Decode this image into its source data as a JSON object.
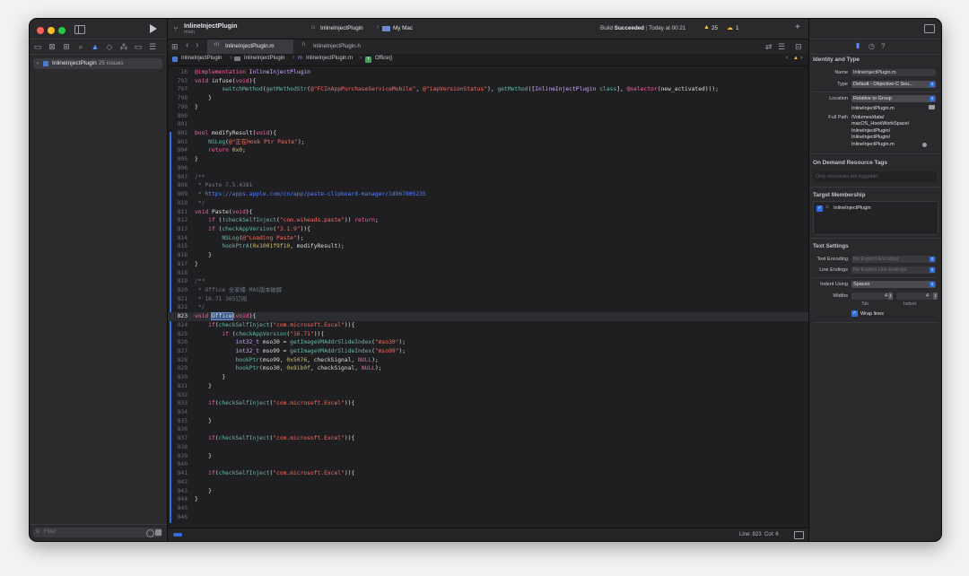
{
  "toolbar": {
    "project_name": "InlineInjectPlugin",
    "branch": "main",
    "scheme": "InlineInjectPlugin",
    "destination": "My Mac",
    "build_status_prefix": "Build",
    "build_status_word": "Succeeded",
    "build_time": "Today at 00:21",
    "warnings_count": "25",
    "errors_count": "1"
  },
  "navigator": {
    "root_item": "InlineInjectPlugin",
    "issues_label": "25 issues",
    "filter_placeholder": "Filter"
  },
  "tabs": [
    {
      "label": "InlineInjectPlugin.m",
      "icon": "m",
      "active": true
    },
    {
      "label": "InlineInjectPlugin.h",
      "icon": "h",
      "active": false
    }
  ],
  "jumpbar": {
    "project": "InlineInjectPlugin",
    "folder": "InlineInjectPlugin",
    "file": "InlineInjectPlugin.m",
    "symbol": "Office()"
  },
  "code_lines": [
    {
      "n": "16",
      "s": [
        [
          "kw",
          "@implementation"
        ],
        [
          "pl",
          " "
        ],
        [
          "ty",
          "InlineInjectPlugin"
        ]
      ]
    },
    {
      "n": "793",
      "s": [
        [
          "kw",
          "void"
        ],
        [
          "pl",
          " "
        ],
        [
          "pl",
          "infuse"
        ],
        [
          "pl",
          "("
        ],
        [
          "kw",
          "void"
        ],
        [
          "pl",
          "){"
        ]
      ]
    },
    {
      "n": "797",
      "s": [
        [
          "pl",
          "        "
        ],
        [
          "fn",
          "switchMethod"
        ],
        [
          "pl",
          "("
        ],
        [
          "fn",
          "getMethodStr"
        ],
        [
          "pl",
          "("
        ],
        [
          "str",
          "@\"FCInAppPurchaseServiceMobile\""
        ],
        [
          "pl",
          ", "
        ],
        [
          "str",
          "@\"iapVersionStatus\""
        ],
        [
          "pl",
          "), "
        ],
        [
          "fn",
          "getMethod"
        ],
        [
          "pl",
          "(["
        ],
        [
          "ty",
          "InlineInjectPlugin"
        ],
        [
          "pl",
          " "
        ],
        [
          "fn",
          "class"
        ],
        [
          "pl",
          "], "
        ],
        [
          "kw",
          "@selector"
        ],
        [
          "pl",
          "(new_activated)));"
        ]
      ]
    },
    {
      "n": "798",
      "s": [
        [
          "pl",
          "    }"
        ]
      ]
    },
    {
      "n": "799",
      "s": [
        [
          "pl",
          "}"
        ]
      ]
    },
    {
      "n": "800",
      "s": []
    },
    {
      "n": "801",
      "s": []
    },
    {
      "n": "802",
      "s": [
        [
          "kw",
          "bool"
        ],
        [
          "pl",
          " modifyResult("
        ],
        [
          "kw",
          "void"
        ],
        [
          "pl",
          "){"
        ]
      ]
    },
    {
      "n": "803",
      "s": [
        [
          "pl",
          "    "
        ],
        [
          "fn",
          "NSLog"
        ],
        [
          "pl",
          "("
        ],
        [
          "str",
          "@\"正在Hook Ptr Paste\""
        ],
        [
          "pl",
          ");"
        ]
      ]
    },
    {
      "n": "804",
      "s": [
        [
          "pl",
          "    "
        ],
        [
          "kw",
          "return"
        ],
        [
          "pl",
          " "
        ],
        [
          "num",
          "0x0"
        ],
        [
          "pl",
          ";"
        ]
      ]
    },
    {
      "n": "805",
      "s": [
        [
          "pl",
          "}"
        ]
      ]
    },
    {
      "n": "806",
      "s": []
    },
    {
      "n": "807",
      "s": [
        [
          "cmt",
          "/**"
        ]
      ]
    },
    {
      "n": "808",
      "s": [
        [
          "cmt",
          " * Paste 7.5.4381"
        ]
      ]
    },
    {
      "n": "809",
      "s": [
        [
          "cmt",
          " * "
        ],
        [
          "link",
          "https://apps.apple.com/cn/app/paste-clipboard-manager/id967805235"
        ]
      ]
    },
    {
      "n": "810",
      "s": [
        [
          "cmt",
          " */"
        ]
      ]
    },
    {
      "n": "811",
      "s": [
        [
          "kw",
          "void"
        ],
        [
          "pl",
          " Paste("
        ],
        [
          "kw",
          "void"
        ],
        [
          "pl",
          "){"
        ]
      ]
    },
    {
      "n": "812",
      "s": [
        [
          "pl",
          "    "
        ],
        [
          "kw",
          "if"
        ],
        [
          "pl",
          " (!"
        ],
        [
          "fn",
          "checkSelfInject"
        ],
        [
          "pl",
          "("
        ],
        [
          "str",
          "\"com.wiheads.paste\""
        ],
        [
          "pl",
          ")) "
        ],
        [
          "kw",
          "return"
        ],
        [
          "pl",
          ";"
        ]
      ]
    },
    {
      "n": "813",
      "s": [
        [
          "pl",
          "    "
        ],
        [
          "kw",
          "if"
        ],
        [
          "pl",
          " ("
        ],
        [
          "fn",
          "checkAppVersion"
        ],
        [
          "pl",
          "("
        ],
        [
          "str",
          "\"3.1.9\""
        ],
        [
          "pl",
          ")){"
        ]
      ]
    },
    {
      "n": "814",
      "s": [
        [
          "pl",
          "        "
        ],
        [
          "fn",
          "NSLog"
        ],
        [
          "pl",
          "("
        ],
        [
          "str",
          "@\"Loading Paste\""
        ],
        [
          "pl",
          ");"
        ]
      ]
    },
    {
      "n": "815",
      "s": [
        [
          "pl",
          "        "
        ],
        [
          "fn",
          "hookPtrA"
        ],
        [
          "pl",
          "("
        ],
        [
          "num",
          "0x1001f9f10"
        ],
        [
          "pl",
          ", modifyResult);"
        ]
      ]
    },
    {
      "n": "816",
      "s": [
        [
          "pl",
          "    }"
        ]
      ]
    },
    {
      "n": "817",
      "s": [
        [
          "pl",
          "}"
        ]
      ]
    },
    {
      "n": "818",
      "s": []
    },
    {
      "n": "819",
      "s": [
        [
          "cmt",
          "/**"
        ]
      ]
    },
    {
      "n": "820",
      "s": [
        [
          "cmt",
          " * Office 全家桶 MAS版本破解"
        ]
      ]
    },
    {
      "n": "821",
      "s": [
        [
          "cmt",
          " * 16.71 365订阅"
        ]
      ]
    },
    {
      "n": "822",
      "s": [
        [
          "cmt",
          " */"
        ]
      ]
    },
    {
      "n": "823",
      "s": [
        [
          "kw",
          "void"
        ],
        [
          "pl",
          " "
        ],
        [
          "sel",
          "Office"
        ],
        [
          "pl",
          "("
        ],
        [
          "kw",
          "void"
        ],
        [
          "pl",
          "){"
        ]
      ]
    },
    {
      "n": "824",
      "s": [
        [
          "pl",
          "    "
        ],
        [
          "kw",
          "if"
        ],
        [
          "pl",
          "("
        ],
        [
          "fn",
          "checkSelfInject"
        ],
        [
          "pl",
          "("
        ],
        [
          "str",
          "\"com.microsoft.Excel\""
        ],
        [
          "pl",
          ")){"
        ]
      ]
    },
    {
      "n": "825",
      "s": [
        [
          "pl",
          "        "
        ],
        [
          "kw",
          "if"
        ],
        [
          "pl",
          " ("
        ],
        [
          "fn",
          "checkAppVersion"
        ],
        [
          "pl",
          "("
        ],
        [
          "str",
          "\"16.71\""
        ],
        [
          "pl",
          ")){"
        ]
      ]
    },
    {
      "n": "826",
      "s": [
        [
          "pl",
          "            "
        ],
        [
          "ty",
          "int32_t"
        ],
        [
          "pl",
          " mso30 = "
        ],
        [
          "fn",
          "getImageVMAddrSlideIndex"
        ],
        [
          "pl",
          "("
        ],
        [
          "str",
          "\"mso30\""
        ],
        [
          "pl",
          ");"
        ]
      ]
    },
    {
      "n": "827",
      "s": [
        [
          "pl",
          "            "
        ],
        [
          "ty",
          "int32_t"
        ],
        [
          "pl",
          " mso99 = "
        ],
        [
          "fn",
          "getImageVMAddrSlideIndex"
        ],
        [
          "pl",
          "("
        ],
        [
          "str",
          "\"mso99\""
        ],
        [
          "pl",
          ");"
        ]
      ]
    },
    {
      "n": "828",
      "s": [
        [
          "pl",
          "            "
        ],
        [
          "fn",
          "hookPtr"
        ],
        [
          "pl",
          "(mso99, "
        ],
        [
          "num",
          "0x5076"
        ],
        [
          "pl",
          ", checkSignal, "
        ],
        [
          "kw",
          "NULL"
        ],
        [
          "pl",
          ");"
        ]
      ]
    },
    {
      "n": "829",
      "s": [
        [
          "pl",
          "            "
        ],
        [
          "fn",
          "hookPtr"
        ],
        [
          "pl",
          "(mso30, "
        ],
        [
          "num",
          "0x8ib0f"
        ],
        [
          "pl",
          ", checkSignal, "
        ],
        [
          "kw",
          "NULL"
        ],
        [
          "pl",
          ");"
        ]
      ]
    },
    {
      "n": "830",
      "s": [
        [
          "pl",
          "        }"
        ]
      ]
    },
    {
      "n": "831",
      "s": [
        [
          "pl",
          "    }"
        ]
      ]
    },
    {
      "n": "832",
      "s": []
    },
    {
      "n": "833",
      "s": [
        [
          "pl",
          "    "
        ],
        [
          "kw",
          "if"
        ],
        [
          "pl",
          "("
        ],
        [
          "fn",
          "checkSelfInject"
        ],
        [
          "pl",
          "("
        ],
        [
          "str",
          "\"com.microsoft.Excel\""
        ],
        [
          "pl",
          ")){"
        ]
      ]
    },
    {
      "n": "834",
      "s": []
    },
    {
      "n": "835",
      "s": [
        [
          "pl",
          "    }"
        ]
      ]
    },
    {
      "n": "836",
      "s": []
    },
    {
      "n": "837",
      "s": [
        [
          "pl",
          "    "
        ],
        [
          "kw",
          "if"
        ],
        [
          "pl",
          "("
        ],
        [
          "fn",
          "checkSelfInject"
        ],
        [
          "pl",
          "("
        ],
        [
          "str",
          "\"com.microsoft.Excel\""
        ],
        [
          "pl",
          ")){"
        ]
      ]
    },
    {
      "n": "838",
      "s": []
    },
    {
      "n": "839",
      "s": [
        [
          "pl",
          "    }"
        ]
      ]
    },
    {
      "n": "840",
      "s": []
    },
    {
      "n": "841",
      "s": [
        [
          "pl",
          "    "
        ],
        [
          "kw",
          "if"
        ],
        [
          "pl",
          "("
        ],
        [
          "fn",
          "checkSelfInject"
        ],
        [
          "pl",
          "("
        ],
        [
          "str",
          "\"com.microsoft.Excel\""
        ],
        [
          "pl",
          ")){"
        ]
      ]
    },
    {
      "n": "842",
      "s": []
    },
    {
      "n": "843",
      "s": [
        [
          "pl",
          "    }"
        ]
      ]
    },
    {
      "n": "844",
      "s": [
        [
          "pl",
          "}"
        ]
      ]
    },
    {
      "n": "845",
      "s": []
    },
    {
      "n": "846",
      "s": []
    }
  ],
  "status_bar": {
    "cursor": "Line: 823  Col: 6"
  },
  "inspector": {
    "identity_title": "Identity and Type",
    "name_label": "Name",
    "name_value": "InlineInjectPlugin.m",
    "type_label": "Type",
    "type_value": "Default - Objective-C Sou...",
    "location_label": "Location",
    "location_value": "Relative to Group",
    "location_file": "InlineInjectPlugin.m",
    "fullpath_label": "Full Path",
    "fullpath_lines": [
      "/Volumes/data/",
      "macOS_HookWorkSpace/",
      "InlineInjectPlugin/",
      "InlineInjectPlugin/",
      "InlineInjectPlugin.m"
    ],
    "odr_title": "On Demand Resource Tags",
    "odr_placeholder": "Only resources are taggable",
    "target_title": "Target Membership",
    "target_item": "InlineInjectPlugin",
    "text_settings_title": "Text Settings",
    "encoding_label": "Text Encoding",
    "encoding_value": "No Explicit Encoding",
    "line_endings_label": "Line Endings",
    "line_endings_value": "No Explicit Line Endings",
    "indent_using_label": "Indent Using",
    "indent_using_value": "Spaces",
    "widths_label": "Widths",
    "tab_value": "4",
    "indent_value": "4",
    "tab_label": "Tab",
    "indent_label": "Indent",
    "wrap_label": "Wrap lines"
  },
  "colors": {
    "accent": "#2f6fe0",
    "warning": "#f5c431",
    "keyword": "#fc5fa3",
    "string": "#fc6a5d"
  }
}
